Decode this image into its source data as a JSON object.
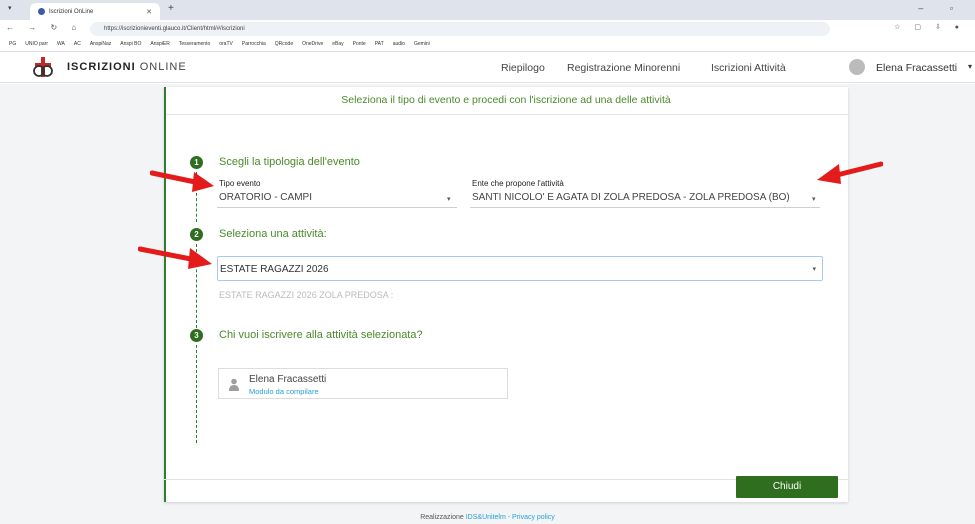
{
  "browser": {
    "tab_title": "Iscrizioni OnLine",
    "url": "https://iscrizionieventi.glauco.it/Client/html/#/iscrizioni",
    "bookmarks": [
      "PG",
      "UNIO parr",
      "WA",
      "AC",
      "AnspiNaz",
      "Anspi BO",
      "AnspiER",
      "Tesseramento",
      "oraTV",
      "Parrocchia",
      "QRcode",
      "OneDrive",
      "eBay",
      "Ponte",
      "PAT",
      "audio",
      "Gemini"
    ]
  },
  "header": {
    "brand_bold": "ISCRIZIONI",
    "brand_rest": "ONLINE",
    "nav": [
      "Riepilogo",
      "Registrazione Minorenni",
      "Iscrizioni Attività"
    ],
    "user": "Elena Fracassetti"
  },
  "main": {
    "headline": "Seleziona il tipo di evento e procedi con l'iscrizione ad una delle attività",
    "steps": [
      {
        "num": "1",
        "title": "Scegli la tipologia dell'evento"
      },
      {
        "num": "2",
        "title": "Seleziona una attività:"
      },
      {
        "num": "3",
        "title": "Chi vuoi iscrivere alla attività selezionata?"
      }
    ],
    "tipo_evento": {
      "label": "Tipo evento",
      "value": "ORATORIO - CAMPI"
    },
    "ente": {
      "label": "Ente che propone l'attività",
      "value": "SANTI NICOLO' E AGATA DI ZOLA PREDOSA - ZOLA PREDOSA (BO)"
    },
    "attivita": {
      "value": "ESTATE RAGAZZI 2026",
      "hint": "ESTATE RAGAZZI 2026 ZOLA PREDOSA :"
    },
    "person": {
      "name": "Elena Fracassetti",
      "status": "Modulo da compilare"
    },
    "close_label": "Chiudi"
  },
  "footer": {
    "prefix": "Realizzazione",
    "link": "IDS&Unitelm - Privacy policy"
  },
  "colors": {
    "accent": "#2e6e1e",
    "link": "#2a9fd6",
    "arrow": "#e31b1b"
  }
}
